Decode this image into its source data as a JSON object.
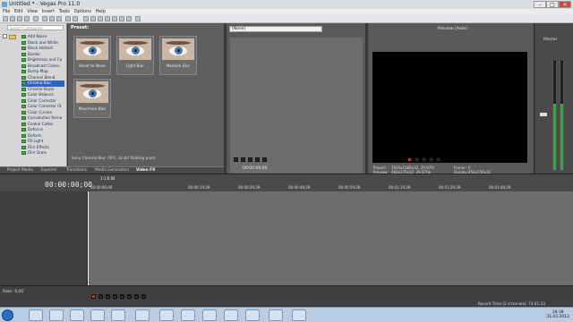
{
  "window": {
    "title": "Untitled * - Vegas Pro 11.0"
  },
  "menu": [
    "File",
    "Edit",
    "View",
    "Insert",
    "Tools",
    "Options",
    "Help"
  ],
  "explorer": {
    "search_placeholder": "Search Categories",
    "effects": [
      "Add Noise",
      "Black and White",
      "Block Hottest",
      "Border",
      "Brightness and Co",
      "Broadcast Colors",
      "Bump Map",
      "Channel Blend",
      "Chroma Blur",
      "Chroma Keyer",
      "Color Balance",
      "Color Corrector",
      "Color Corrector (S",
      "Color Curves",
      "Convolution Kerne",
      "Cookie Cutter",
      "Defocus",
      "Deform",
      "Fill Light",
      "Film Effects",
      "Film Grain"
    ],
    "selected": "Chroma Blur"
  },
  "presets": {
    "header": "Preset:",
    "items": [
      "Reset to None",
      "Light Blur",
      "Medium Blur",
      "Maximum Blur"
    ],
    "description": "Sony Chroma Blur: OFX, 32-bit floating point"
  },
  "tabs": [
    "Project Media",
    "Explorer",
    "Transitions",
    "Media Generators",
    "Video FX"
  ],
  "active_tab": "Video FX",
  "trimmer": {
    "source": "(None)",
    "time": "00:00:00;00"
  },
  "preview": {
    "mode": "Preview (Auto)",
    "project_label": "Project:",
    "project_value": "1920x1080x32, 29.970i",
    "preview_label": "Preview:",
    "preview_value": "480x270x32, 29.970p",
    "frame_label": "Frame:",
    "frame_value": "0",
    "display_label": "Display:",
    "display_value": "456x256x32"
  },
  "master": {
    "label": "Master",
    "level_fraction": 0.6
  },
  "timeline": {
    "timecode": "00:00:00;00",
    "marker": "1:1:0.04",
    "ruler": [
      "00:00:00;00",
      "00:00:14;29",
      "00:00:29;29",
      "00:00:44;29",
      "00:00:59;28",
      "00:01:14;29",
      "00:01:29;29",
      "00:01:44;29"
    ]
  },
  "status": {
    "rate": "Rate: 0,00",
    "record_time": "Record Time (2 channels): 73:41:23"
  },
  "clock": {
    "time": "18:38",
    "date": "31.03.2012"
  }
}
